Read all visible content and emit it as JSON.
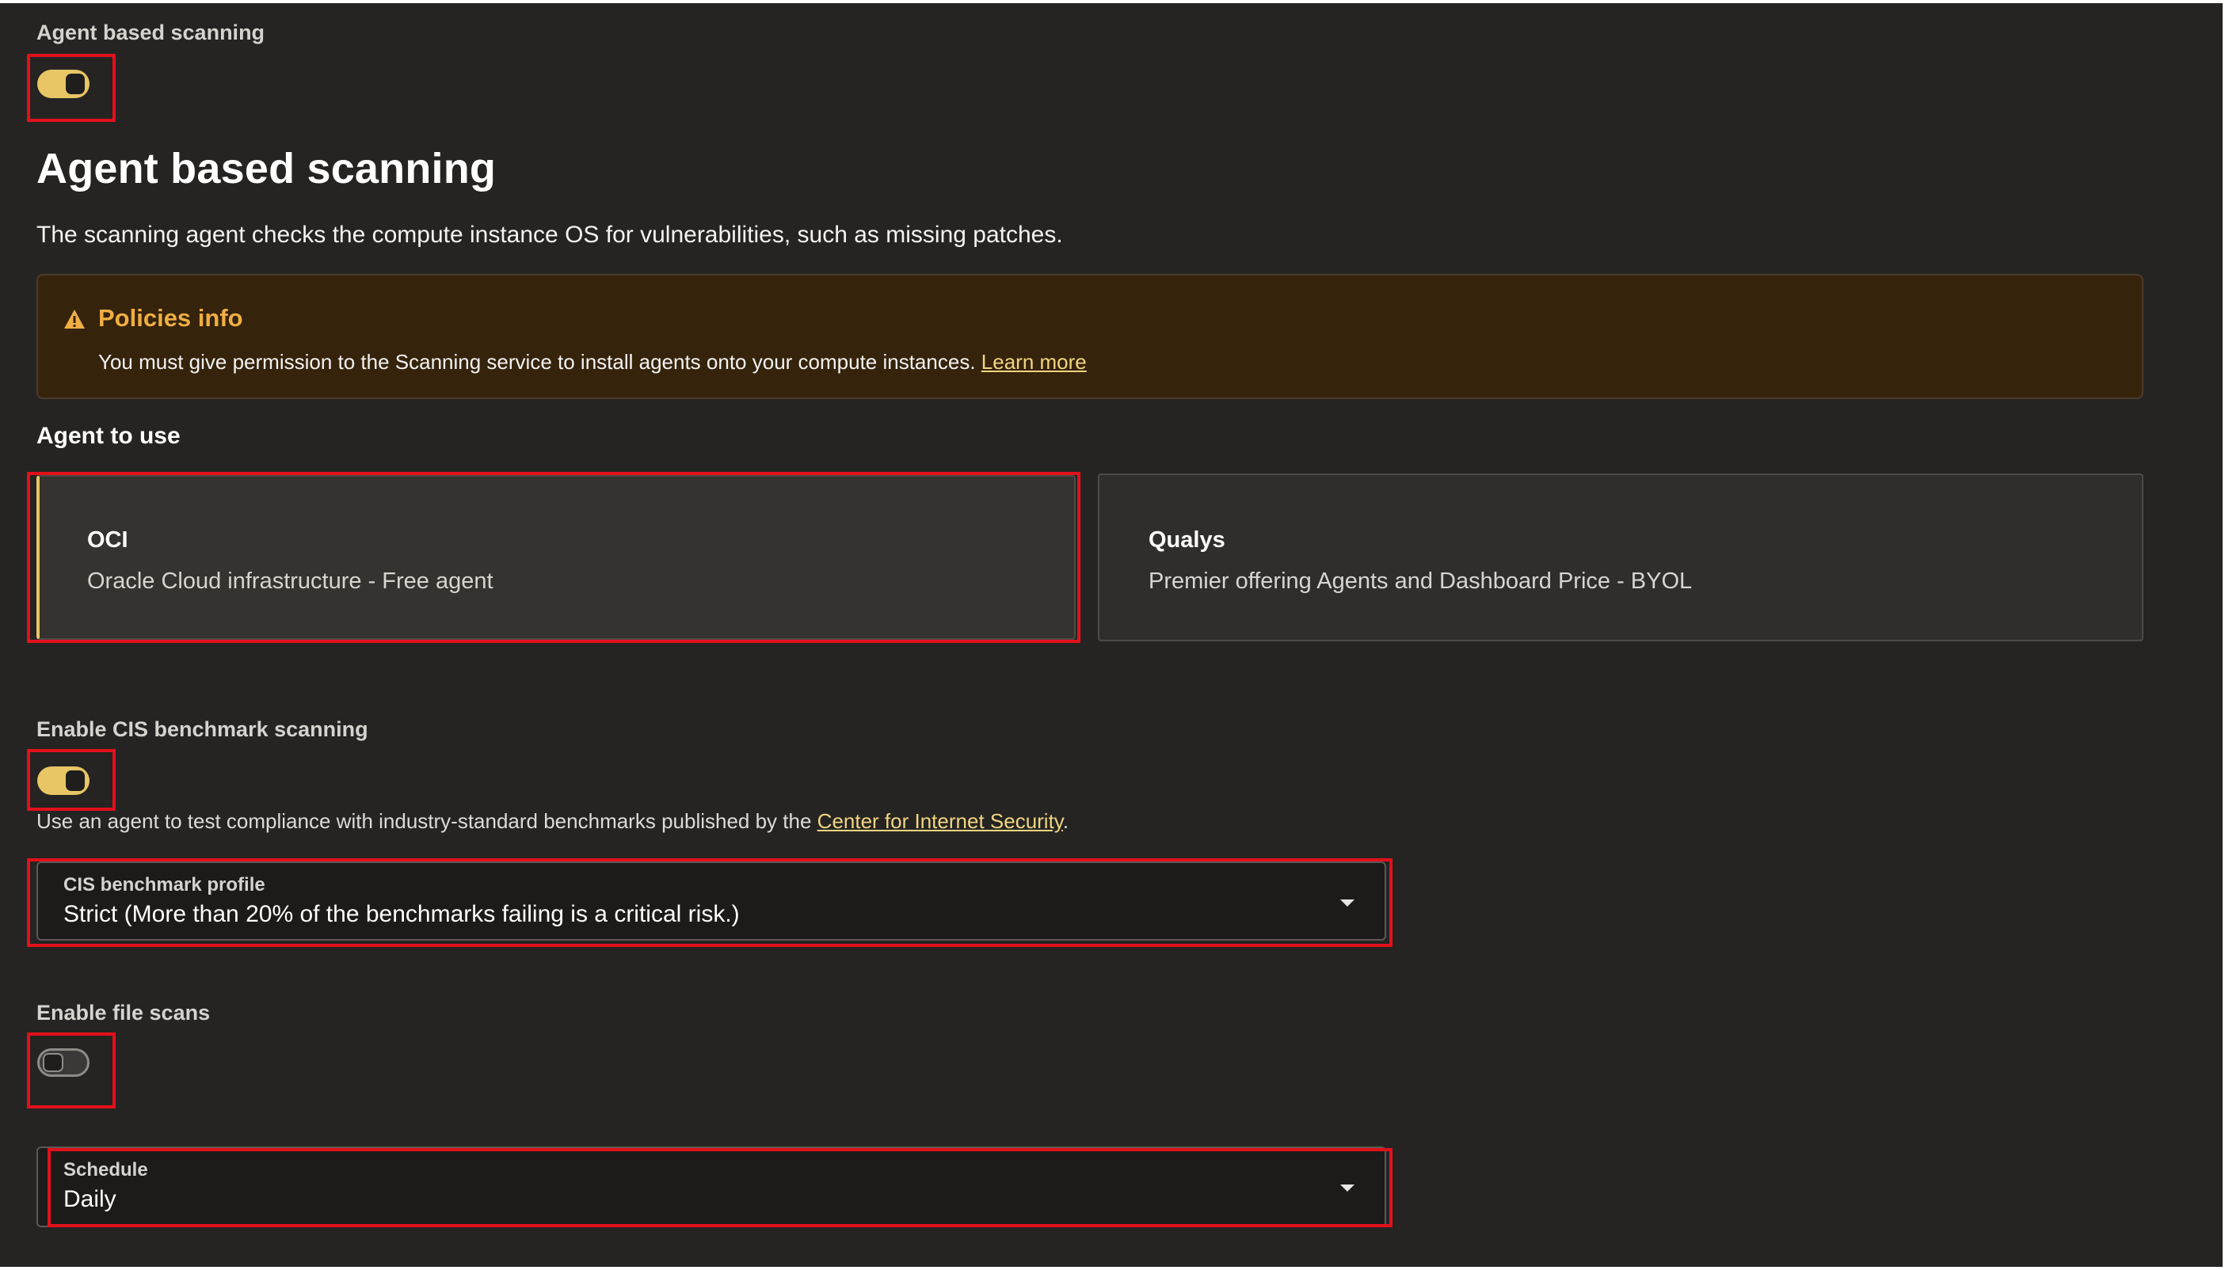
{
  "agent_scanning": {
    "toggle_label": "Agent based scanning",
    "toggle_state": "on",
    "heading": "Agent based scanning",
    "description": "The scanning agent checks the compute instance OS for vulnerabilities, such as missing patches."
  },
  "policies_alert": {
    "icon": "warning-icon",
    "title": "Policies info",
    "text": "You must give permission to the Scanning service to install agents onto your compute instances.",
    "link": "Learn more"
  },
  "agent_to_use": {
    "label": "Agent to use",
    "options": [
      {
        "title": "OCI",
        "subtitle": "Oracle Cloud infrastructure - Free agent",
        "selected": true
      },
      {
        "title": "Qualys",
        "subtitle": "Premier offering Agents and Dashboard Price - BYOL",
        "selected": false
      }
    ]
  },
  "cis": {
    "toggle_label": "Enable CIS benchmark scanning",
    "toggle_state": "on",
    "helper_prefix": "Use an agent to test compliance with industry-standard benchmarks published by the",
    "helper_link": "Center for Internet Security",
    "helper_suffix": ".",
    "profile_label": "CIS benchmark profile",
    "profile_value": "Strict (More than 20% of the benchmarks failing is a critical risk.)"
  },
  "file_scans": {
    "toggle_label": "Enable file scans",
    "toggle_state": "off"
  },
  "schedule": {
    "label": "Schedule",
    "value": "Daily"
  },
  "colors": {
    "background": "#252422",
    "toggle_on": "#e8c565",
    "highlight_box": "#e3101b",
    "alert_title": "#f0ae43",
    "link": "#f1d581"
  }
}
